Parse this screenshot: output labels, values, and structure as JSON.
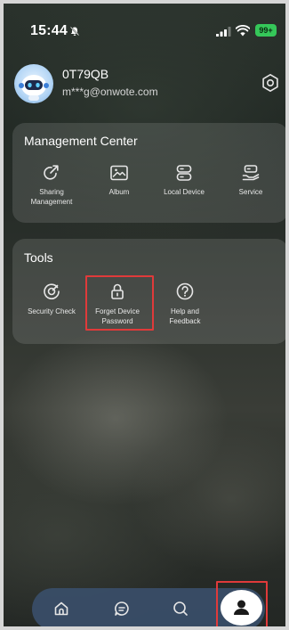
{
  "status_bar": {
    "time": "15:44",
    "battery": "99+",
    "icons": [
      "bell-off-icon",
      "signal-icon",
      "wifi-icon",
      "battery-icon"
    ]
  },
  "profile": {
    "username": "0T79QB",
    "email": "m***g@onwote.com",
    "settings_icon": "settings-icon"
  },
  "management_center": {
    "title": "Management Center",
    "items": [
      {
        "label_line1": "Sharing",
        "label_line2": "Management",
        "icon": "share-icon"
      },
      {
        "label": "Album",
        "icon": "image-icon"
      },
      {
        "label": "Local Device",
        "icon": "storage-icon"
      },
      {
        "label": "Service",
        "icon": "service-icon"
      }
    ]
  },
  "tools": {
    "title": "Tools",
    "items": [
      {
        "label": "Security Check",
        "icon": "security-check-icon"
      },
      {
        "label_line1": "Forget Device",
        "label_line2": "Password",
        "icon": "lock-icon",
        "highlighted": true
      },
      {
        "label_line1": "Help and",
        "label_line2": "Feedback",
        "icon": "help-icon"
      }
    ]
  },
  "bottom_nav": {
    "items": [
      "home-icon",
      "message-icon",
      "search-icon",
      "profile-icon"
    ],
    "active": "profile-icon",
    "highlighted": "profile-icon"
  },
  "colors": {
    "highlight": "#e03a3a",
    "battery": "#35c759",
    "nav_bg": "#3a4e69"
  }
}
